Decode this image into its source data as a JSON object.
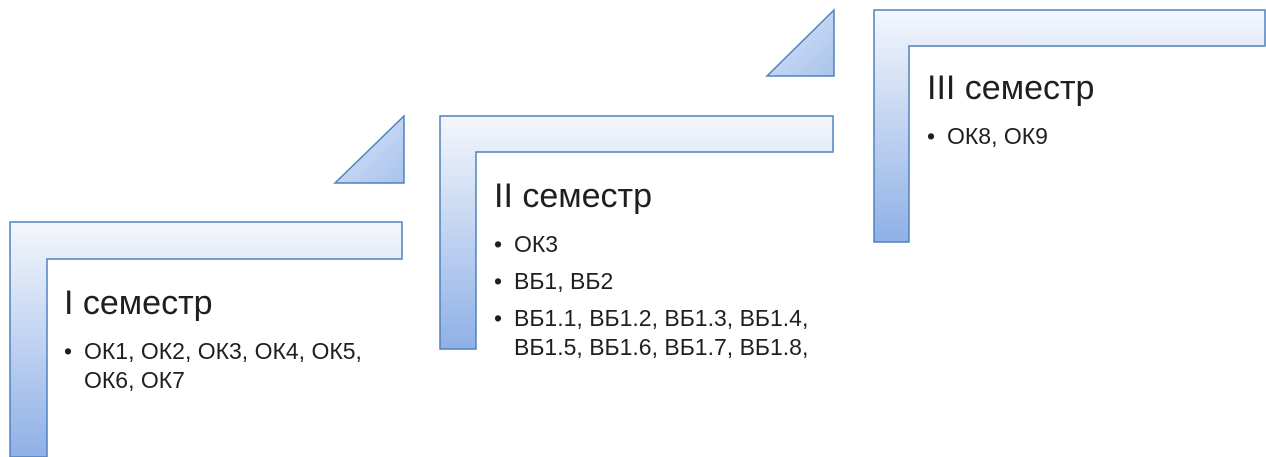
{
  "diagram": {
    "stages": [
      {
        "title": "I семестр",
        "items": [
          "ОК1, ОК2, ОК3, ОК4, ОК5, ОК6, ОК7"
        ]
      },
      {
        "title": "II семестр",
        "items": [
          "ОК3",
          "ВБ1, ВБ2",
          "ВБ1.1, ВБ1.2, ВБ1.3, ВБ1.4, ВБ1.5, ВБ1.6, ВБ1.7, ВБ1.8,"
        ]
      },
      {
        "title": "III семестр",
        "items": [
          "ОК8, ОК9"
        ]
      }
    ],
    "colors": {
      "fill_light": "#eef3fb",
      "fill_dark": "#a9c3ec",
      "stroke": "#4f81bd",
      "text": "#1f1f1f"
    }
  }
}
